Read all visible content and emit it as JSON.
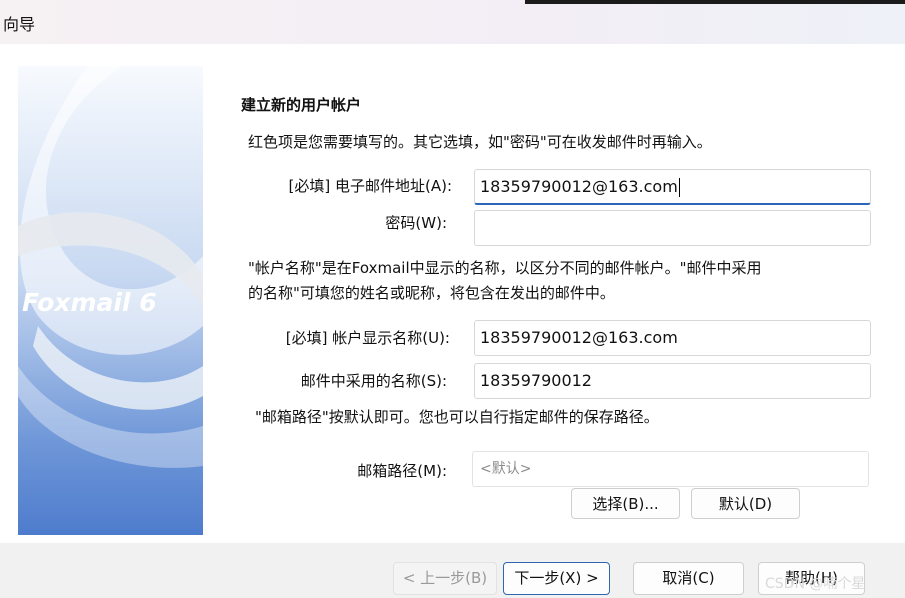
{
  "window": {
    "title": "向导"
  },
  "banner": {
    "logo_text": "Foxmail 6"
  },
  "form": {
    "heading": "建立新的用户帐户",
    "intro": "红色项是您需要填写的。其它选填，如\"密码\"可在收发邮件时再输入。",
    "email": {
      "label": "[必填] 电子邮件地址(A):",
      "value": "18359790012@163.com"
    },
    "password": {
      "label": "密码(W):",
      "value": ""
    },
    "account_note_line1": "\"帐户名称\"是在Foxmail中显示的名称，以区分不同的邮件帐户。\"邮件中采用",
    "account_note_line2": "的名称\"可填您的姓名或昵称，将包含在发出的邮件中。",
    "display_name": {
      "label": "[必填] 帐户显示名称(U):",
      "value": "18359790012@163.com"
    },
    "mail_name": {
      "label": "邮件中采用的名称(S):",
      "value": "18359790012"
    },
    "path_note": "\"邮箱路径\"按默认即可。您也可以自行指定邮件的保存路径。",
    "mail_path": {
      "label": "邮箱路径(M):",
      "value": "<默认>"
    },
    "browse_button": "选择(B)...",
    "default_button": "默认(D)"
  },
  "footer": {
    "back_button": "< 上一步(B)",
    "next_button": "下一步(X) >",
    "cancel_button": "取消(C)",
    "help_button": "帮助(H)"
  },
  "watermark": "CSDN @喃个星",
  "colors": {
    "accent": "#2a67b8",
    "banner_bottom": "#4e7ccd"
  }
}
